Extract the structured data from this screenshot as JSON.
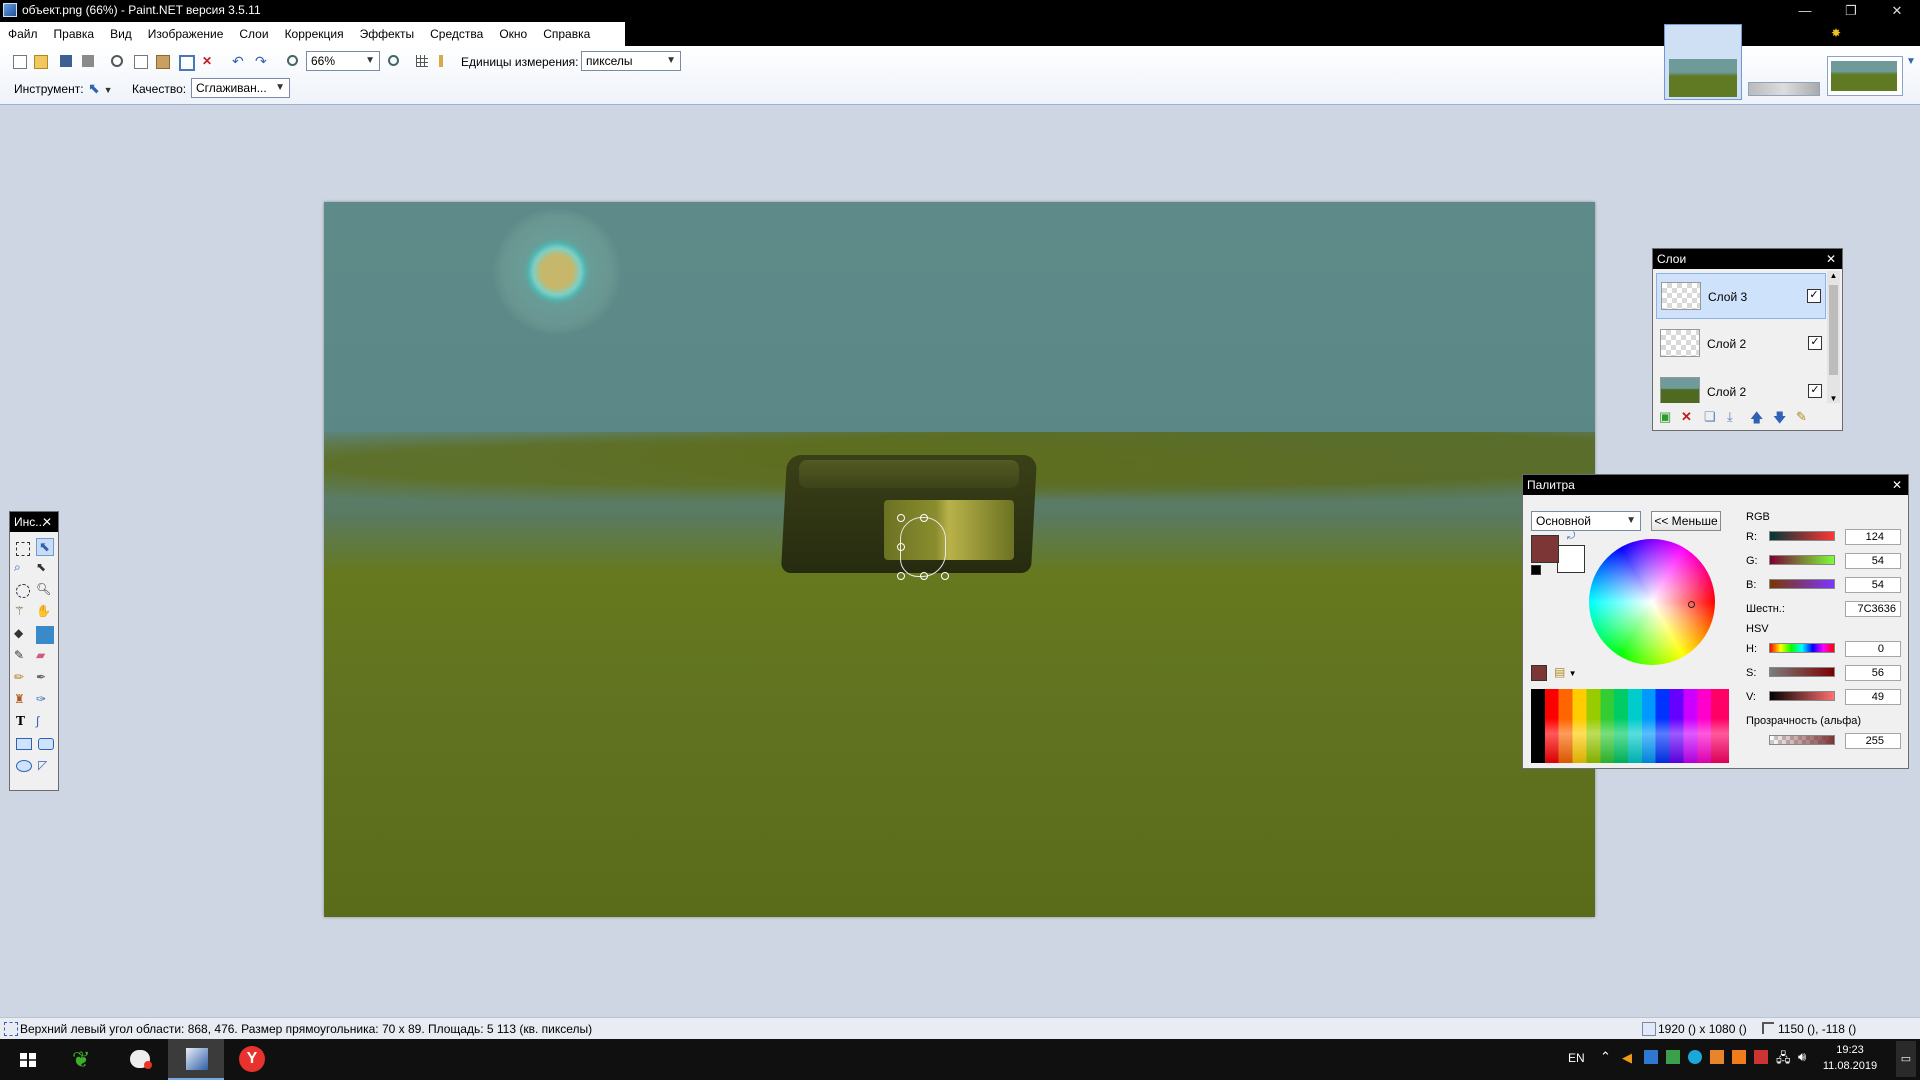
{
  "window": {
    "title": "объект.png (66%) - Paint.NET версия 3.5.11",
    "controls": [
      "—",
      "❐",
      "✕"
    ]
  },
  "menu": [
    "Файл",
    "Правка",
    "Вид",
    "Изображение",
    "Слои",
    "Коррекция",
    "Эффекты",
    "Средства",
    "Окно",
    "Справка"
  ],
  "toolbar": {
    "zoom_value": "66%",
    "units_label": "Единицы измерения:",
    "units_value": "пикселы",
    "tool_label": "Инструмент:",
    "quality_label": "Качество:",
    "quality_value": "Сглаживан..."
  },
  "tools_window": {
    "title": "Инс..."
  },
  "layers_window": {
    "title": "Слои",
    "layers": [
      {
        "name": "Слой 3",
        "visible": true,
        "selected": true
      },
      {
        "name": "Слой 2",
        "visible": true,
        "selected": false
      },
      {
        "name": "Слой 2",
        "visible": true,
        "selected": false
      }
    ]
  },
  "palette_window": {
    "title": "Палитра",
    "mode": "Основной",
    "less_button": "<< Меньше",
    "rgb_label": "RGB",
    "hsv_label": "HSV",
    "r_label": "R:",
    "r": "124",
    "g_label": "G:",
    "g": "54",
    "b_label": "B:",
    "b": "54",
    "hex_label": "Шестн.:",
    "hex": "7C3636",
    "h_label": "H:",
    "h": "0",
    "s_label": "S:",
    "s": "56",
    "v_label": "V:",
    "v": "49",
    "alpha_label": "Прозрачность (альфа)",
    "alpha": "255",
    "primary_color": "#7c3636"
  },
  "status": {
    "message": "Верхний левый угол области: 868, 476. Размер прямоугольника: 70 x 89. Площадь: 5 113 (кв. пикселы)",
    "image_size": "1920 () x 1080 ()",
    "cursor": "1150 (), -118 ()"
  },
  "taskbar": {
    "lang": "EN",
    "time": "19:23",
    "date": "11.08.2019"
  }
}
